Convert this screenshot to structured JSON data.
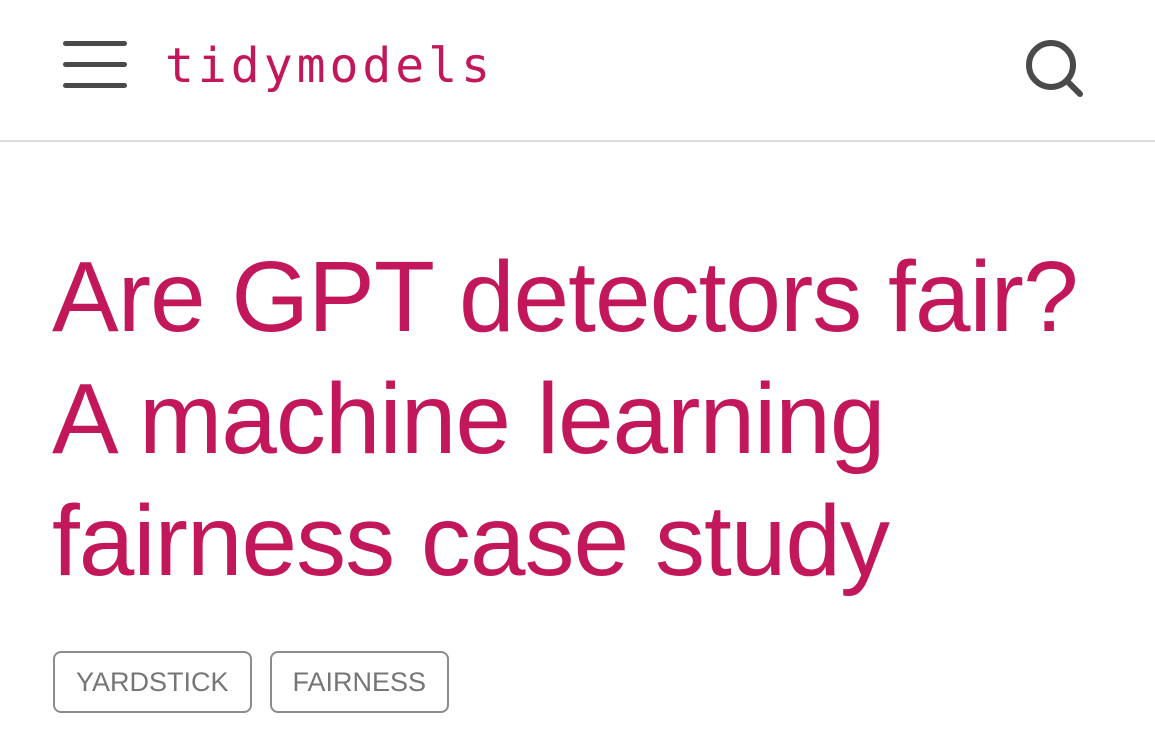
{
  "header": {
    "brand": "tidymodels",
    "menu_icon": "hamburger-menu-icon",
    "search_icon": "search-icon"
  },
  "article": {
    "title": "Are GPT detectors fair? A machine learning fairness case study",
    "tags": [
      "YARDSTICK",
      "FAIRNESS"
    ]
  },
  "colors": {
    "accent": "#c2185b",
    "icon": "#4a4a4a",
    "tag_border": "#8c8c8c",
    "tag_text": "#767676",
    "divider": "#dcdcdc"
  }
}
